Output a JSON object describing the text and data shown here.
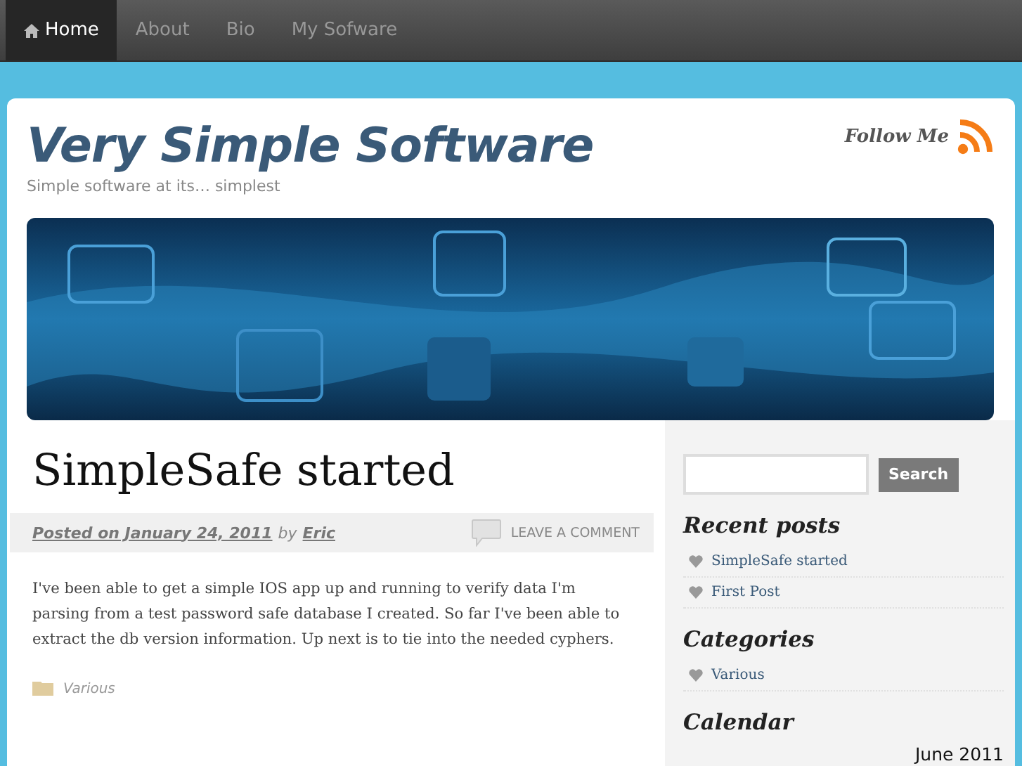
{
  "nav": [
    {
      "label": "Home",
      "selected": true,
      "kind": "home"
    },
    {
      "label": "About",
      "selected": false,
      "kind": "text"
    },
    {
      "label": "Bio",
      "selected": false,
      "kind": "text"
    },
    {
      "label": "My Sofware",
      "selected": false,
      "kind": "text"
    }
  ],
  "site": {
    "title": "Very Simple Software",
    "tagline": "Simple software at its… simplest",
    "follow": "Follow Me"
  },
  "post": {
    "title": "SimpleSafe started",
    "posted": "Posted on January 24, 2011",
    "by": "by",
    "author": "Eric",
    "comment": "LEAVE A COMMENT",
    "body": "I've been able to get a simple IOS app up and running to verify data I'm parsing from a test password safe database I created. So far I've been able to extract the db version information. Up next is to tie into the needed cyphers.",
    "category": "Various"
  },
  "sidebar": {
    "search_button": "Search",
    "widgets": [
      {
        "title": "Recent posts",
        "items": [
          "SimpleSafe started",
          "First Post"
        ]
      },
      {
        "title": "Categories",
        "items": [
          "Various"
        ]
      },
      {
        "title": "Calendar",
        "month": "June 2011"
      }
    ]
  }
}
